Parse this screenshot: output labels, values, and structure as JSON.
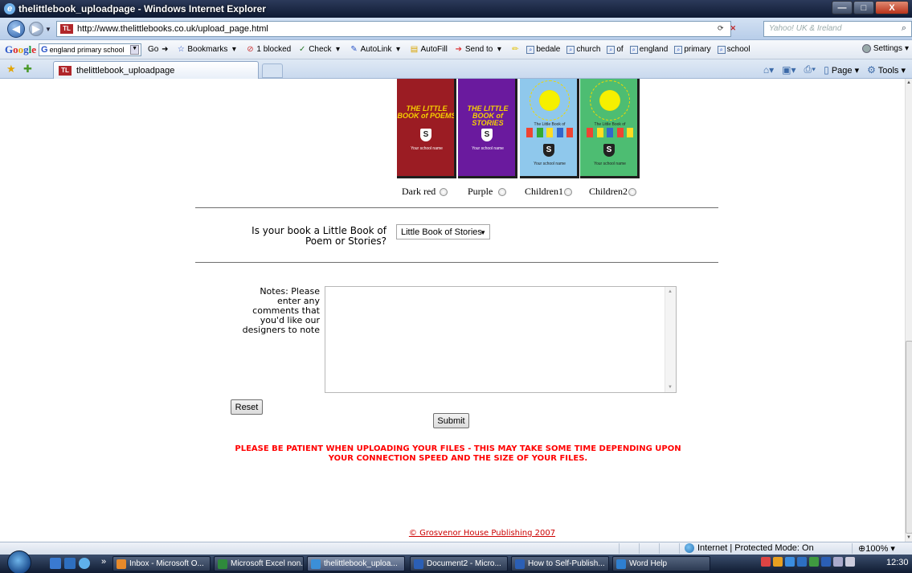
{
  "window": {
    "title": "thelittlebook_uploadpage - Windows Internet Explorer",
    "controls": {
      "minimize": "—",
      "maximize": "□",
      "close": "X"
    }
  },
  "address_bar": {
    "url": "http://www.thelittlebooks.co.uk/upload_page.html",
    "search_placeholder": "Yahoo! UK & Ireland",
    "site_icon": "TL"
  },
  "google_toolbar": {
    "search_value": "england primary school",
    "go": "Go",
    "bookmarks": "Bookmarks",
    "blocked": "1 blocked",
    "check": "Check",
    "autolink": "AutoLink",
    "autofill": "AutoFill",
    "send_to": "Send to",
    "search_terms": [
      "bedale",
      "church",
      "of",
      "england",
      "primary",
      "school"
    ],
    "settings": "Settings"
  },
  "tab": {
    "title": "thelittlebook_uploadpage"
  },
  "command_bar": {
    "page": "Page",
    "tools": "Tools"
  },
  "covers": [
    {
      "label": "Dark red",
      "color": "#9b1c23",
      "title": "THE LITTLE BOOK of POEMS",
      "school": "Your school name"
    },
    {
      "label": "Purple",
      "color": "#6a1a9e",
      "title": "THE LITTLE BOOK of STORIES",
      "school": "Your school name"
    },
    {
      "label": "Children1",
      "color": "#8fc8ec",
      "title": "The Little Book of",
      "school": "Your school name"
    },
    {
      "label": "Children2",
      "color": "#4dbd72",
      "title": "The Little Book of",
      "school": "Your school name"
    }
  ],
  "form": {
    "book_type_question": "Is your book a Little Book of Poem or Stories?",
    "book_type_selected": "Little Book of Stories",
    "notes_label": "Notes: Please enter any comments that you'd like our designers to note",
    "notes_value": "",
    "reset_label": "Reset",
    "submit_label": "Submit"
  },
  "warning": "PLEASE BE PATIENT WHEN UPLOADING YOUR FILES - THIS MAY TAKE SOME TIME DEPENDING UPON YOUR CONNECTION SPEED AND THE SIZE OF YOUR FILES.",
  "footer": "© Grosvenor House Publishing 2007",
  "status_bar": {
    "zone": "Internet | Protected Mode: On",
    "zoom": "100%"
  },
  "taskbar": {
    "items": [
      {
        "label": "Inbox - Microsoft O...",
        "color": "#e88a2a",
        "active": false
      },
      {
        "label": "Microsoft Excel non...",
        "color": "#2f8a3c",
        "active": false
      },
      {
        "label": "thelittlebook_uploa...",
        "color": "#3b8fd8",
        "active": true
      },
      {
        "label": "Document2 - Micro...",
        "color": "#2b5fb5",
        "active": false
      },
      {
        "label": "How to Self-Publish...",
        "color": "#2b5fb5",
        "active": false
      },
      {
        "label": "Word Help",
        "color": "#2e7fd0",
        "active": false
      }
    ],
    "clock": "12:30"
  }
}
